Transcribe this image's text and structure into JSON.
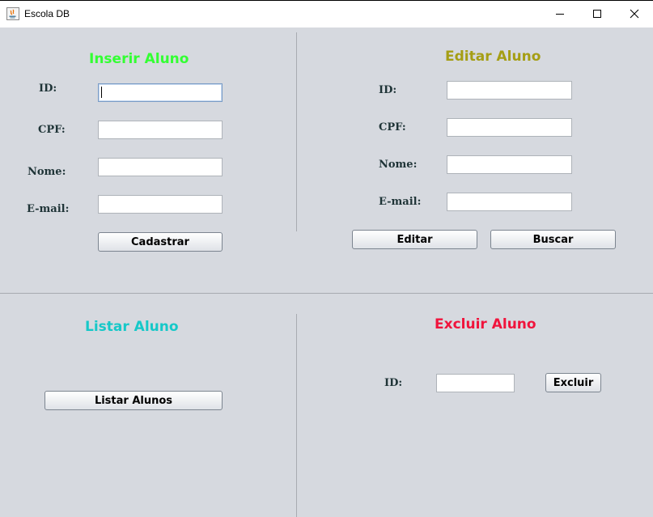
{
  "window": {
    "title": "Escola DB",
    "controls": [
      "minimize",
      "maximize",
      "close"
    ]
  },
  "inserir": {
    "heading": "Inserir Aluno",
    "heading_color": "#33ff33",
    "labels": {
      "id": "ID:",
      "cpf": "CPF:",
      "nome": "Nome:",
      "email": "E-mail:"
    },
    "values": {
      "id": "",
      "cpf": "",
      "nome": "",
      "email": ""
    },
    "button": "Cadastrar"
  },
  "editar": {
    "heading": "Editar Aluno",
    "heading_color": "#a59e14",
    "labels": {
      "id": "ID:",
      "cpf": "CPF:",
      "nome": "Nome:",
      "email": "E-mail:"
    },
    "values": {
      "id": "",
      "cpf": "",
      "nome": "",
      "email": ""
    },
    "edit_button": "Editar",
    "search_button": "Buscar"
  },
  "listar": {
    "heading": "Listar Aluno",
    "heading_color": "#16c8c8",
    "button": "Listar Alunos"
  },
  "excluir": {
    "heading": "Excluir Aluno",
    "heading_color": "#f0143c",
    "labels": {
      "id": "ID:"
    },
    "values": {
      "id": ""
    },
    "button": "Excluir"
  }
}
